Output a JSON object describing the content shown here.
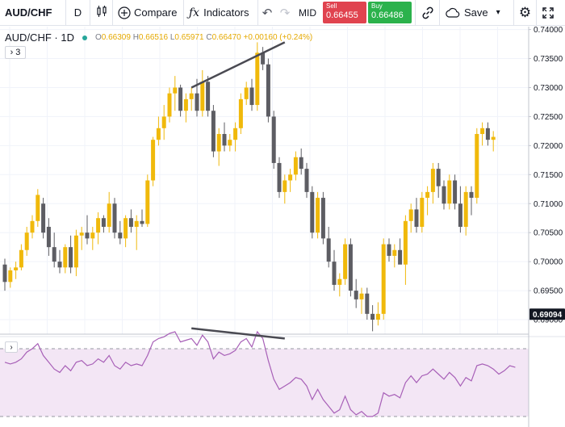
{
  "toolbar": {
    "symbol": "AUD/CHF",
    "interval": "D",
    "compare_label": "Compare",
    "indicators_label": "Indicators",
    "mid_label": "MID",
    "sell_label": "Sell",
    "sell_price": "0.66455",
    "buy_label": "Buy",
    "buy_price": "0.66486",
    "save_label": "Save"
  },
  "legend": {
    "symbol": "AUD/CHF",
    "interval": "1D",
    "open_key": "O",
    "open": "0.66309",
    "high_key": "H",
    "high": "0.66516",
    "low_key": "L",
    "low": "0.65971",
    "close_key": "C",
    "close": "0.66470",
    "change": "+0.00160 (+0.24%)",
    "collapse_count": "3"
  },
  "colors": {
    "up": "#f0b90b",
    "down": "#5d5d63",
    "rsi_line": "#a75fb7",
    "rsi_band": "#f3e6f5",
    "trendline": "#4a4a52",
    "last_price_bg": "#131722"
  },
  "icons": [
    "candles-icon",
    "plus-circle-icon",
    "fx-icon",
    "undo-icon",
    "redo-icon",
    "link-icon",
    "cloud-icon",
    "chevron-down-icon",
    "gear-icon",
    "fullscreen-icon",
    "chevron-right-icon"
  ],
  "chart_data": {
    "type": "candlestick",
    "ylim": [
      0.6875,
      0.7405
    ],
    "y_ticks": [
      "0.74000",
      "0.73500",
      "0.73000",
      "0.72500",
      "0.72000",
      "0.71500",
      "0.71000",
      "0.70500",
      "0.70000",
      "0.69500",
      "0.69000"
    ],
    "last_price": "0.69094",
    "ohlc": [
      [
        0.6995,
        0.7005,
        0.695,
        0.6965
      ],
      [
        0.6965,
        0.699,
        0.6955,
        0.6985
      ],
      [
        0.6985,
        0.7,
        0.697,
        0.699
      ],
      [
        0.699,
        0.703,
        0.6985,
        0.702
      ],
      [
        0.702,
        0.706,
        0.701,
        0.705
      ],
      [
        0.705,
        0.708,
        0.704,
        0.707
      ],
      [
        0.707,
        0.7125,
        0.706,
        0.7115
      ],
      [
        0.71,
        0.711,
        0.704,
        0.705
      ],
      [
        0.706,
        0.7075,
        0.701,
        0.7025
      ],
      [
        0.7025,
        0.705,
        0.699,
        0.7
      ],
      [
        0.7,
        0.702,
        0.698,
        0.699
      ],
      [
        0.699,
        0.703,
        0.698,
        0.7025
      ],
      [
        0.7025,
        0.7045,
        0.698,
        0.699
      ],
      [
        0.699,
        0.7055,
        0.6975,
        0.7045
      ],
      [
        0.7045,
        0.706,
        0.702,
        0.705
      ],
      [
        0.705,
        0.708,
        0.703,
        0.704
      ],
      [
        0.704,
        0.706,
        0.702,
        0.705
      ],
      [
        0.705,
        0.7085,
        0.703,
        0.7075
      ],
      [
        0.7075,
        0.708,
        0.705,
        0.706
      ],
      [
        0.706,
        0.712,
        0.705,
        0.71
      ],
      [
        0.71,
        0.711,
        0.704,
        0.705
      ],
      [
        0.705,
        0.707,
        0.703,
        0.704
      ],
      [
        0.704,
        0.708,
        0.7025,
        0.7075
      ],
      [
        0.7075,
        0.709,
        0.705,
        0.706
      ],
      [
        0.706,
        0.708,
        0.702,
        0.707
      ],
      [
        0.707,
        0.709,
        0.706,
        0.7065
      ],
      [
        0.7065,
        0.715,
        0.706,
        0.714
      ],
      [
        0.714,
        0.7215,
        0.713,
        0.721
      ],
      [
        0.721,
        0.725,
        0.72,
        0.723
      ],
      [
        0.723,
        0.727,
        0.721,
        0.725
      ],
      [
        0.725,
        0.73,
        0.724,
        0.729
      ],
      [
        0.729,
        0.732,
        0.726,
        0.73
      ],
      [
        0.73,
        0.7305,
        0.725,
        0.726
      ],
      [
        0.726,
        0.729,
        0.724,
        0.728
      ],
      [
        0.728,
        0.73,
        0.726,
        0.729
      ],
      [
        0.729,
        0.7315,
        0.725,
        0.726
      ],
      [
        0.726,
        0.733,
        0.725,
        0.731
      ],
      [
        0.731,
        0.732,
        0.725,
        0.726
      ],
      [
        0.726,
        0.727,
        0.718,
        0.719
      ],
      [
        0.719,
        0.723,
        0.7165,
        0.722
      ],
      [
        0.722,
        0.724,
        0.719,
        0.72
      ],
      [
        0.72,
        0.722,
        0.719,
        0.721
      ],
      [
        0.721,
        0.724,
        0.719,
        0.723
      ],
      [
        0.723,
        0.729,
        0.722,
        0.728
      ],
      [
        0.728,
        0.731,
        0.727,
        0.73
      ],
      [
        0.73,
        0.7315,
        0.726,
        0.727
      ],
      [
        0.727,
        0.7378,
        0.726,
        0.736
      ],
      [
        0.736,
        0.737,
        0.733,
        0.734
      ],
      [
        0.734,
        0.735,
        0.724,
        0.725
      ],
      [
        0.725,
        0.726,
        0.716,
        0.717
      ],
      [
        0.717,
        0.718,
        0.711,
        0.712
      ],
      [
        0.712,
        0.715,
        0.71,
        0.714
      ],
      [
        0.714,
        0.716,
        0.712,
        0.715
      ],
      [
        0.715,
        0.719,
        0.714,
        0.718
      ],
      [
        0.718,
        0.7195,
        0.715,
        0.716
      ],
      [
        0.716,
        0.717,
        0.711,
        0.712
      ],
      [
        0.712,
        0.713,
        0.704,
        0.705
      ],
      [
        0.705,
        0.712,
        0.704,
        0.711
      ],
      [
        0.711,
        0.712,
        0.703,
        0.704
      ],
      [
        0.704,
        0.706,
        0.699,
        0.7
      ],
      [
        0.7,
        0.702,
        0.695,
        0.696
      ],
      [
        0.696,
        0.698,
        0.694,
        0.697
      ],
      [
        0.697,
        0.704,
        0.696,
        0.703
      ],
      [
        0.703,
        0.704,
        0.694,
        0.695
      ],
      [
        0.695,
        0.697,
        0.692,
        0.6935
      ],
      [
        0.6935,
        0.6955,
        0.691,
        0.6945
      ],
      [
        0.6945,
        0.6955,
        0.69,
        0.691
      ],
      [
        0.691,
        0.6925,
        0.688,
        0.69
      ],
      [
        0.69,
        0.693,
        0.689,
        0.691
      ],
      [
        0.691,
        0.704,
        0.69,
        0.703
      ],
      [
        0.703,
        0.704,
        0.7,
        0.701
      ],
      [
        0.701,
        0.703,
        0.699,
        0.702
      ],
      [
        0.702,
        0.704,
        0.7,
        0.6995
      ],
      [
        0.6995,
        0.708,
        0.696,
        0.707
      ],
      [
        0.707,
        0.71,
        0.705,
        0.709
      ],
      [
        0.709,
        0.711,
        0.705,
        0.706
      ],
      [
        0.706,
        0.712,
        0.705,
        0.711
      ],
      [
        0.711,
        0.713,
        0.708,
        0.712
      ],
      [
        0.712,
        0.717,
        0.71,
        0.716
      ],
      [
        0.716,
        0.717,
        0.711,
        0.713
      ],
      [
        0.713,
        0.714,
        0.709,
        0.71
      ],
      [
        0.71,
        0.715,
        0.709,
        0.714
      ],
      [
        0.714,
        0.715,
        0.709,
        0.71
      ],
      [
        0.71,
        0.713,
        0.705,
        0.706
      ],
      [
        0.706,
        0.713,
        0.7045,
        0.712
      ],
      [
        0.712,
        0.713,
        0.708,
        0.711
      ],
      [
        0.711,
        0.723,
        0.71,
        0.722
      ],
      [
        0.722,
        0.724,
        0.72,
        0.723
      ],
      [
        0.723,
        0.724,
        0.72,
        0.721
      ],
      [
        0.721,
        0.7225,
        0.719,
        0.7215
      ]
    ],
    "rsi": [
      62,
      61,
      62,
      64,
      68,
      70,
      73,
      66,
      62,
      58,
      56,
      60,
      57,
      62,
      63,
      60,
      61,
      64,
      62,
      66,
      60,
      58,
      62,
      60,
      61,
      60,
      66,
      74,
      76,
      77,
      79,
      80,
      74,
      75,
      76,
      72,
      78,
      74,
      64,
      68,
      66,
      67,
      69,
      74,
      76,
      71,
      80,
      76,
      63,
      52,
      46,
      48,
      50,
      53,
      52,
      48,
      40,
      46,
      40,
      36,
      32,
      34,
      42,
      34,
      31,
      33,
      30,
      30,
      32,
      44,
      42,
      43,
      41,
      50,
      54,
      50,
      54,
      55,
      58,
      55,
      52,
      56,
      53,
      48,
      53,
      51,
      60,
      61,
      60,
      58,
      55,
      57,
      60,
      59
    ]
  }
}
